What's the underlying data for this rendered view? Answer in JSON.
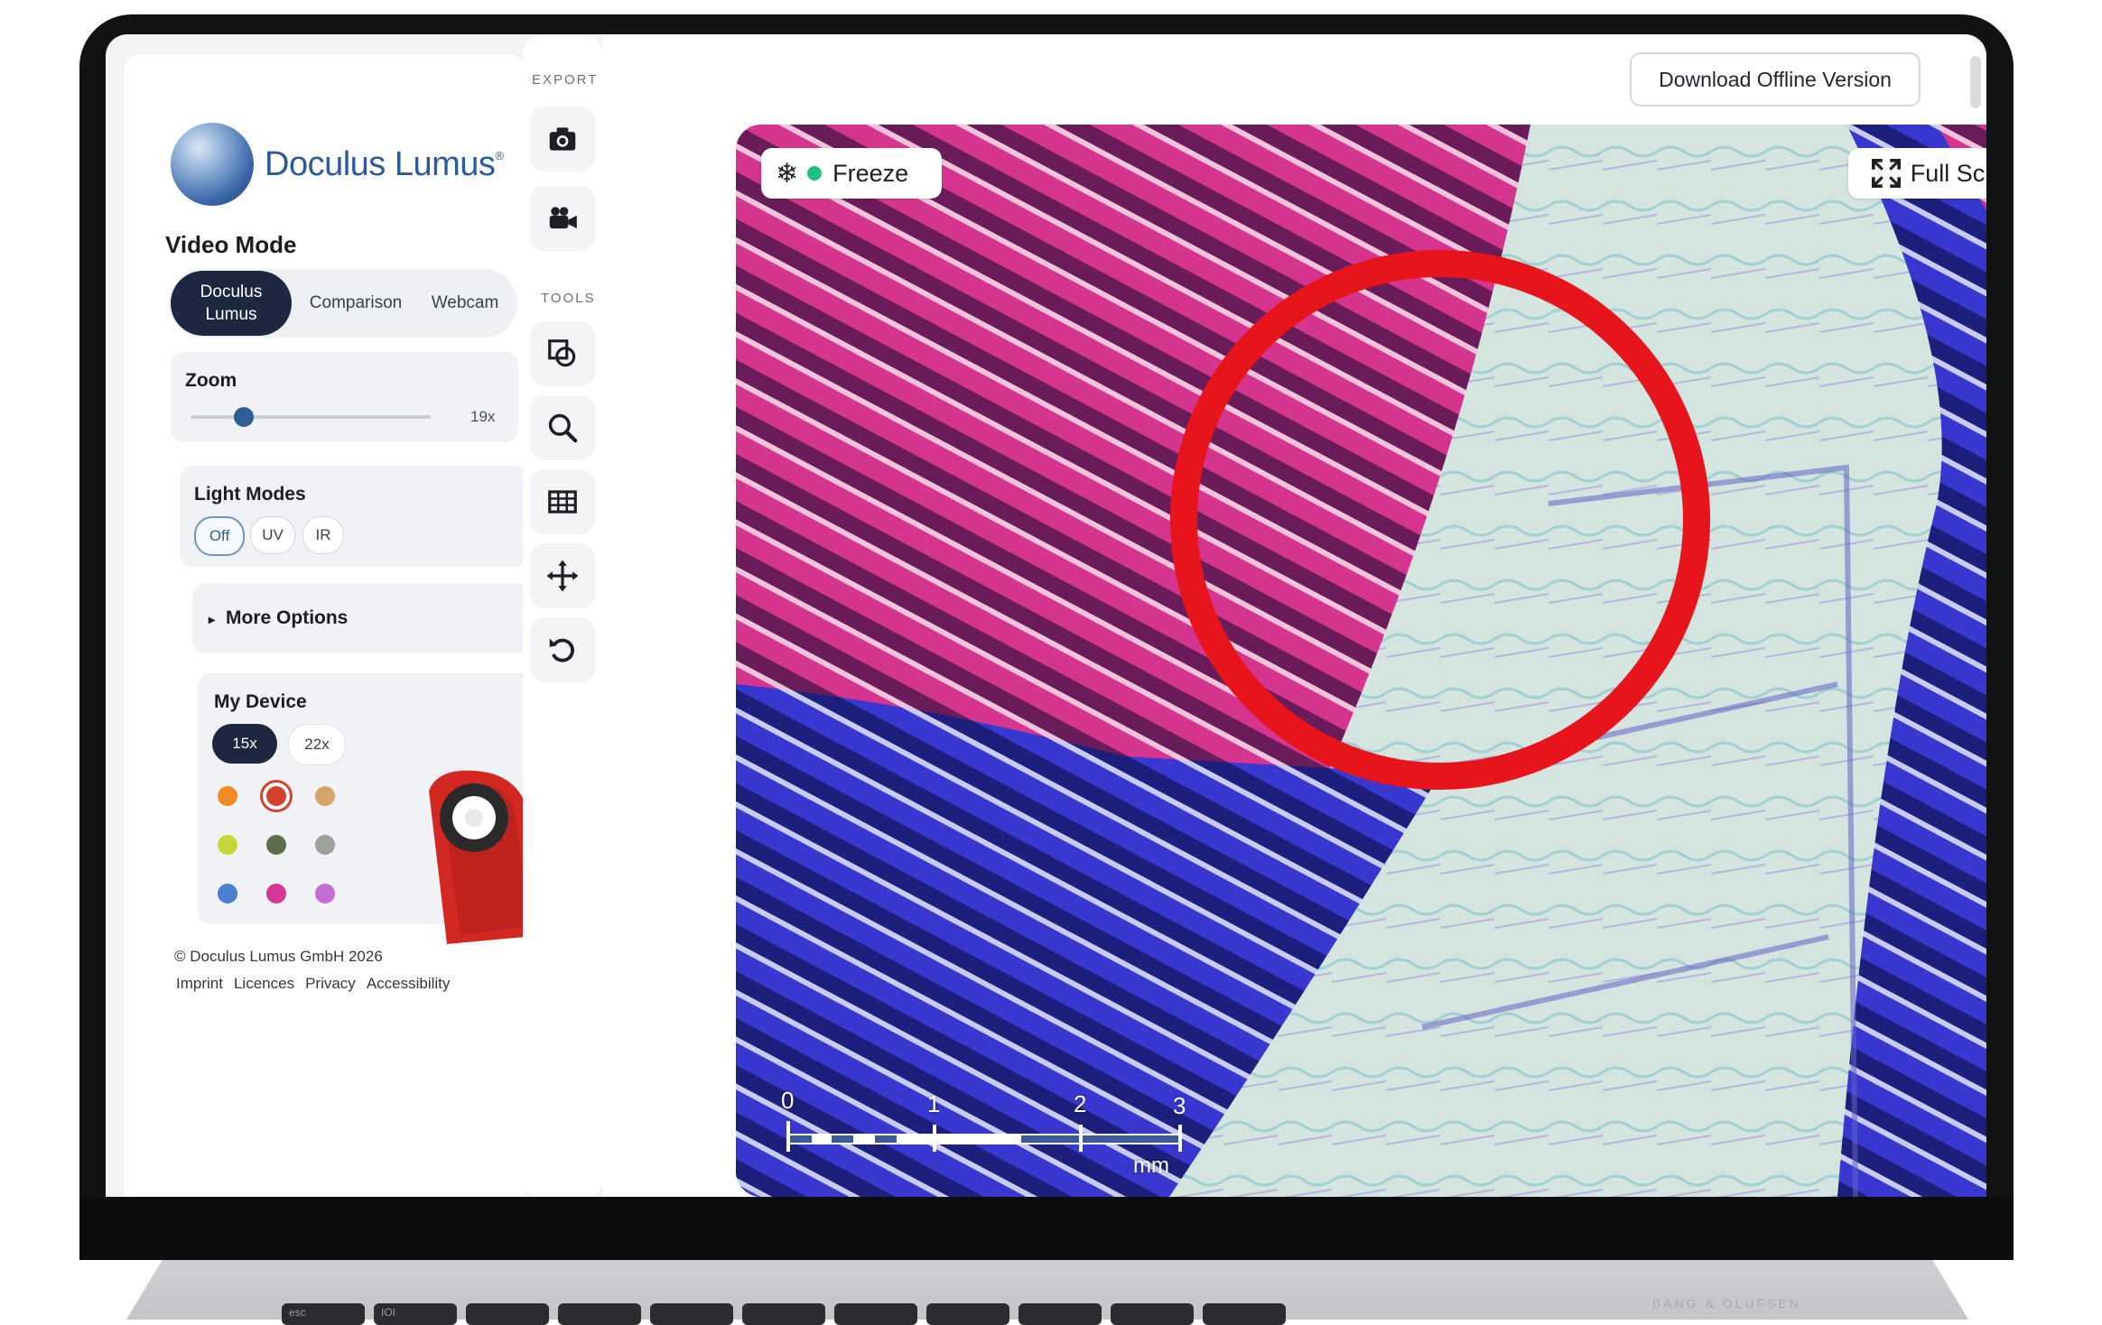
{
  "brand": {
    "name": "Doculus Lumus",
    "trademark": "®"
  },
  "video_mode": {
    "title": "Video Mode",
    "segments": [
      {
        "label": "Doculus\nLumus",
        "active": true
      },
      {
        "label": "Comparison",
        "active": false
      },
      {
        "label": "Webcam",
        "active": false
      }
    ]
  },
  "zoom": {
    "title": "Zoom",
    "value_label": "19x",
    "level_fraction": 0.22
  },
  "light_modes": {
    "title": "Light Modes",
    "options": [
      "Off",
      "UV",
      "IR"
    ],
    "selected": "Off"
  },
  "more_options": {
    "label": "More Options",
    "marker": "▸"
  },
  "my_device": {
    "title": "My Device",
    "magnifications": [
      "15x",
      "22x"
    ],
    "selected": "15x",
    "colors": [
      "#f08a24",
      "#d6402f",
      "#d6a56a",
      "#c9d63a",
      "#5c6e4a",
      "#9ea29c",
      "#4a7fd4",
      "#d43a95",
      "#c56bd6"
    ],
    "selected_color": "#d6402f"
  },
  "footer": {
    "copyright": "© Doculus Lumus GmbH 2026",
    "links": [
      "Imprint",
      "Licences",
      "Privacy",
      "Accessibility"
    ]
  },
  "toolbar": {
    "export_label": "EXPORT",
    "tools_label": "TOOLS",
    "export_tools": [
      "camera-icon",
      "video-camera-icon"
    ],
    "tools": [
      "shapes-icon",
      "search-icon",
      "grid-icon",
      "move-icon",
      "rotate-icon"
    ]
  },
  "header": {
    "download_label": "Download Offline Version"
  },
  "viewer": {
    "freeze_label": "Freeze",
    "fullscreen_label": "Full Screen",
    "annotation_color": "#e8141c",
    "scale": {
      "ticks": [
        "0",
        "1",
        "2",
        "3"
      ],
      "unit": "mm"
    }
  },
  "laptop": {
    "brand": "BANG & OLUFSEN",
    "keys": [
      "esc",
      "IOI",
      "",
      "",
      "",
      "",
      "",
      "",
      "",
      "",
      ""
    ]
  }
}
